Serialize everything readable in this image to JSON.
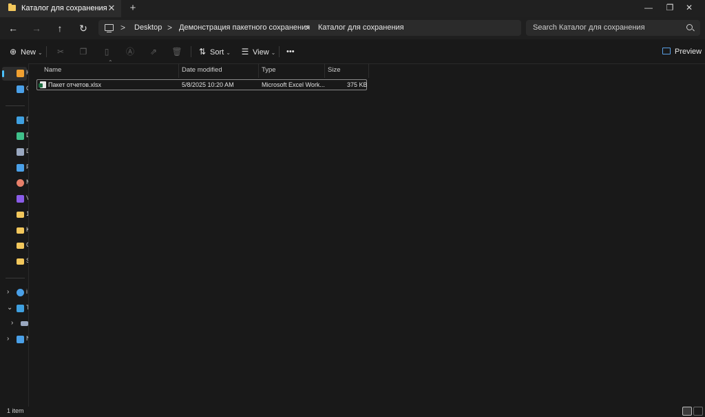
{
  "window": {
    "tab_title": "Каталог для сохранения",
    "tab_close": "✕",
    "new_tab": "+",
    "minimize": "—",
    "maximize": "❐",
    "close": "✕"
  },
  "nav": {
    "back": "←",
    "forward": "→",
    "up": "↑",
    "refresh": "↻",
    "breadcrumb": [
      "Desktop",
      "Демонстрация пакетного сохранения",
      "Каталог для сохранения"
    ],
    "separator": ">",
    "search_placeholder": "Search Каталог для сохранения"
  },
  "toolbar": {
    "new_label": "New",
    "sort_label": "Sort",
    "view_label": "View",
    "more_label": "•••",
    "preview_label": "Preview"
  },
  "sidebar": {
    "items": [
      {
        "label": "H",
        "icon": "home-icon",
        "color": "#f0a030"
      },
      {
        "label": "G",
        "icon": "gallery-icon",
        "color": "#4aa0e8"
      },
      {
        "label": "D",
        "icon": "desktop-icon",
        "color": "#3fa0e0"
      },
      {
        "label": "D",
        "icon": "downloads-icon",
        "color": "#3fc08a"
      },
      {
        "label": "D",
        "icon": "documents-icon",
        "color": "#9aa8c0"
      },
      {
        "label": "P",
        "icon": "pictures-icon",
        "color": "#4aa0e8"
      },
      {
        "label": "M",
        "icon": "music-icon",
        "color": "#e8806a"
      },
      {
        "label": "V",
        "icon": "videos-icon",
        "color": "#8a5ce8"
      },
      {
        "label": "1",
        "icon": "folder-icon",
        "color": "#f2c75c"
      },
      {
        "label": "K",
        "icon": "folder-icon",
        "color": "#f2c75c"
      },
      {
        "label": "C",
        "icon": "folder-icon",
        "color": "#f2c75c"
      },
      {
        "label": "S",
        "icon": "folder-icon",
        "color": "#f2c75c"
      },
      {
        "label": "i",
        "icon": "cloud-icon",
        "color": "#4aa0e8"
      },
      {
        "label": "T",
        "icon": "this-pc-icon",
        "color": "#3fa0e0"
      },
      {
        "label": "",
        "icon": "drive-icon",
        "color": "#9aa8c0"
      },
      {
        "label": "N",
        "icon": "network-icon",
        "color": "#4aa0e8"
      }
    ]
  },
  "columns": {
    "name": "Name",
    "date": "Date modified",
    "type": "Type",
    "size": "Size"
  },
  "files": [
    {
      "name": "Пакет отчетов.xlsx",
      "date": "5/8/2025 10:20 AM",
      "type": "Microsoft Excel Work...",
      "size": "375 KB"
    }
  ],
  "status": {
    "item_count": "1 item"
  }
}
